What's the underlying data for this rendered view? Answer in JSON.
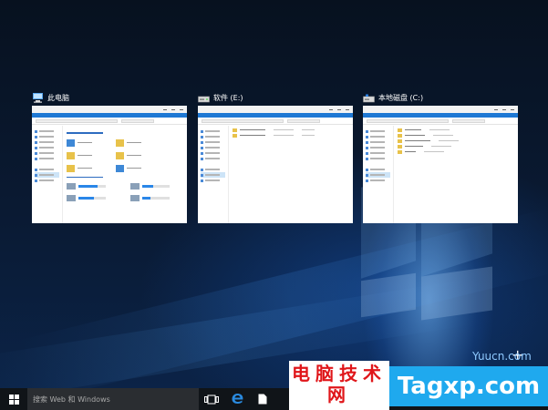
{
  "task_view": {
    "windows": [
      {
        "title": "此电脑",
        "icon": "computer-icon"
      },
      {
        "title": "软件 (E:)",
        "icon": "drive-icon"
      },
      {
        "title": "本地磁盘 (C:)",
        "icon": "drive-icon"
      }
    ]
  },
  "taskbar": {
    "search_placeholder": "搜索 Web 和 Windows",
    "start_icon": "windows-logo-icon",
    "task_view_icon": "task-view-icon",
    "edge_icon": "edge-browser-icon",
    "file_icon": "document-icon"
  },
  "watermark": {
    "site_small": "Yuucn.com",
    "cn_text": "电脑技术网",
    "en_text": "Tagxp.com"
  },
  "colors": {
    "accent": "#1e78d4",
    "watermark_red": "#e0161a",
    "watermark_blue": "#1fa9ee",
    "taskbar": "#101418"
  }
}
